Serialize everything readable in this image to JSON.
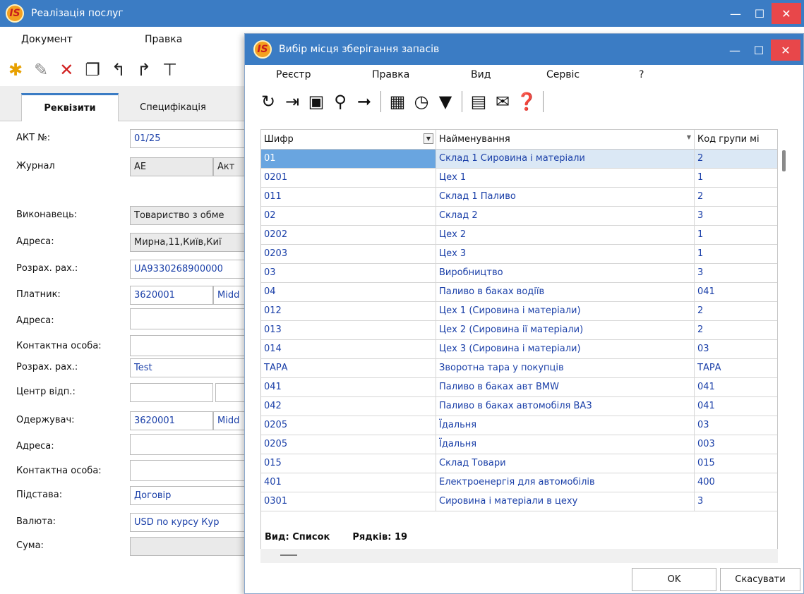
{
  "main_window": {
    "title": "Реалізація послуг",
    "app_logo": "IS",
    "menu": [
      "Документ",
      "Правка"
    ],
    "toolbar_icons": [
      "new-doc-icon",
      "edit-doc-icon",
      "delete-doc-icon",
      "copy-doc-icon",
      "import-doc-icon",
      "export-doc-icon",
      "more-icon"
    ],
    "tabs": [
      "Реквізити",
      "Специфікація"
    ],
    "fields": {
      "act_label": "АКТ №:",
      "act_value": "01/25",
      "journal_label": "Журнал",
      "journal_value": "АЕ",
      "journal_value2": "Акт",
      "executor_label": "Виконавець:",
      "executor_value": "Товариство з обме",
      "address1_label": "Адреса:",
      "address1_value": "Мирна,11,Київ,Киї",
      "account1_label": "Розрах. рах.:",
      "account1_value": "UA9330268900000",
      "payer_label": "Платник:",
      "payer_code": "3620001",
      "payer_name": "Midd",
      "address2_label": "Адреса:",
      "contact1_label": "Контактна особа:",
      "account2_label": "Розрах. рах.:",
      "account2_value": "Test",
      "center_label": "Центр відп.:",
      "receiver_label": "Одержувач:",
      "receiver_code": "3620001",
      "receiver_name": "Midd",
      "address3_label": "Адреса:",
      "contact2_label": "Контактна особа:",
      "basis_label": "Підстава:",
      "basis_value": "Договір",
      "currency_label": "Валюта:",
      "currency_value": "USD по курсу Кур",
      "sum_label": "Сума:"
    }
  },
  "dialog": {
    "title": "Вибір місця зберігання запасів",
    "app_logo": "IS",
    "menu": [
      "Реєстр",
      "Правка",
      "Вид",
      "Сервіс",
      "?"
    ],
    "toolbar_icons": [
      "refresh-icon",
      "exit-icon",
      "save-icon",
      "search-icon",
      "find-next-icon",
      "table-icon",
      "history-icon",
      "clear-filter-icon",
      "document-icon",
      "mail-icon",
      "help-icon"
    ],
    "columns": [
      "Шифр",
      "Найменування",
      "Код групи мі"
    ],
    "rows": [
      [
        "01",
        "Склад 1 Сировина і матеріали",
        "2"
      ],
      [
        "0201",
        "Цех 1",
        "1"
      ],
      [
        "011",
        "Склад 1 Паливо",
        "2"
      ],
      [
        "02",
        "Склад 2",
        "3"
      ],
      [
        "0202",
        "Цех 2",
        "1"
      ],
      [
        "0203",
        "Цех 3",
        "1"
      ],
      [
        "03",
        "Виробництво",
        "3"
      ],
      [
        "04",
        "Паливо в баках водіїв",
        "041"
      ],
      [
        "012",
        "Цех 1 (Сировина і матеріали)",
        "2"
      ],
      [
        "013",
        "Цех 2 (Сировина ії  матеріали)",
        "2"
      ],
      [
        "014",
        "Цех 3 (Сировина і матеріали)",
        "03"
      ],
      [
        "ТАРА",
        "Зворотна тара у покупців",
        "ТАРА"
      ],
      [
        "041",
        "Паливо в баках авт BMW",
        "041"
      ],
      [
        "042",
        "Паливо в баках автомобіля ВАЗ",
        "041"
      ],
      [
        "0205",
        "Їдальня",
        "03"
      ],
      [
        "0205",
        "Їдальня",
        "003"
      ],
      [
        "015",
        "Склад Товари",
        "015"
      ],
      [
        "401",
        "Електроенергія для автомобілів",
        "400"
      ],
      [
        "0301",
        "Сировина і матеріали в цеху",
        "3"
      ]
    ],
    "selected_row": 0,
    "view_label": "Вид: Список",
    "rows_label": "Рядків: 19",
    "ok_label": "OK",
    "cancel_label": "Скасувати"
  }
}
